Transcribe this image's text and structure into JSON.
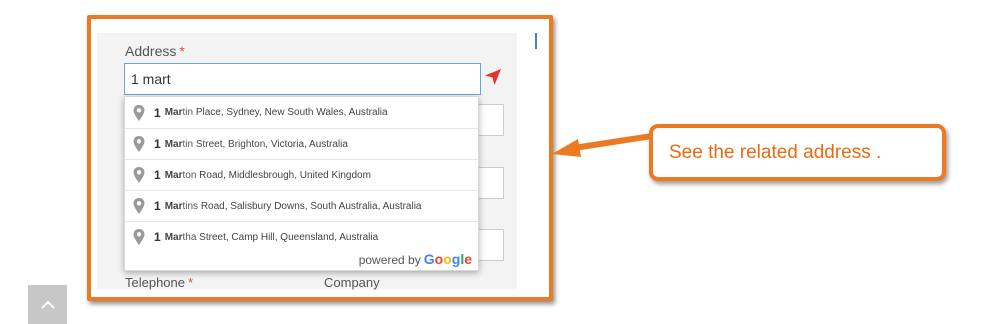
{
  "form": {
    "address_label": "Address",
    "required_mark": "*",
    "address_value": "1 mart",
    "telephone_label": "Telephone",
    "company_label": "Company"
  },
  "suggestions": [
    {
      "number": "1",
      "match": "Mar",
      "rest_bold": "tin",
      "rest": " Place, Sydney, New South Wales, Australia"
    },
    {
      "number": "1",
      "match": "Mar",
      "rest_bold": "tin",
      "rest": " Street, Brighton, Victoria, Australia"
    },
    {
      "number": "1",
      "match": "Mar",
      "rest_bold": "ton",
      "rest": " Road, Middlesbrough, United Kingdom"
    },
    {
      "number": "1",
      "match": "Mar",
      "rest_bold": "tins",
      "rest": " Road, Salisbury Downs, South Australia, Australia"
    },
    {
      "number": "1",
      "match": "Mar",
      "rest_bold": "tha",
      "rest": " Street, Camp Hill, Queensland, Australia"
    }
  ],
  "powered_by": "powered by",
  "google_letters": [
    "G",
    "o",
    "o",
    "g",
    "l",
    "e"
  ],
  "google_colors": [
    "#4285F4",
    "#EA4335",
    "#FBBC05",
    "#4285F4",
    "#34A853",
    "#EA4335"
  ],
  "callout": {
    "text": "See the related address ."
  },
  "colors": {
    "accent_orange": "#ec7a22",
    "callout_text": "#e86a12",
    "required_red": "#e24b3b",
    "locate_red": "#e5322d"
  },
  "icons": {
    "locate": "location-arrow-icon",
    "pin": "map-pin-icon",
    "scroll_top": "chevron-up-icon"
  }
}
